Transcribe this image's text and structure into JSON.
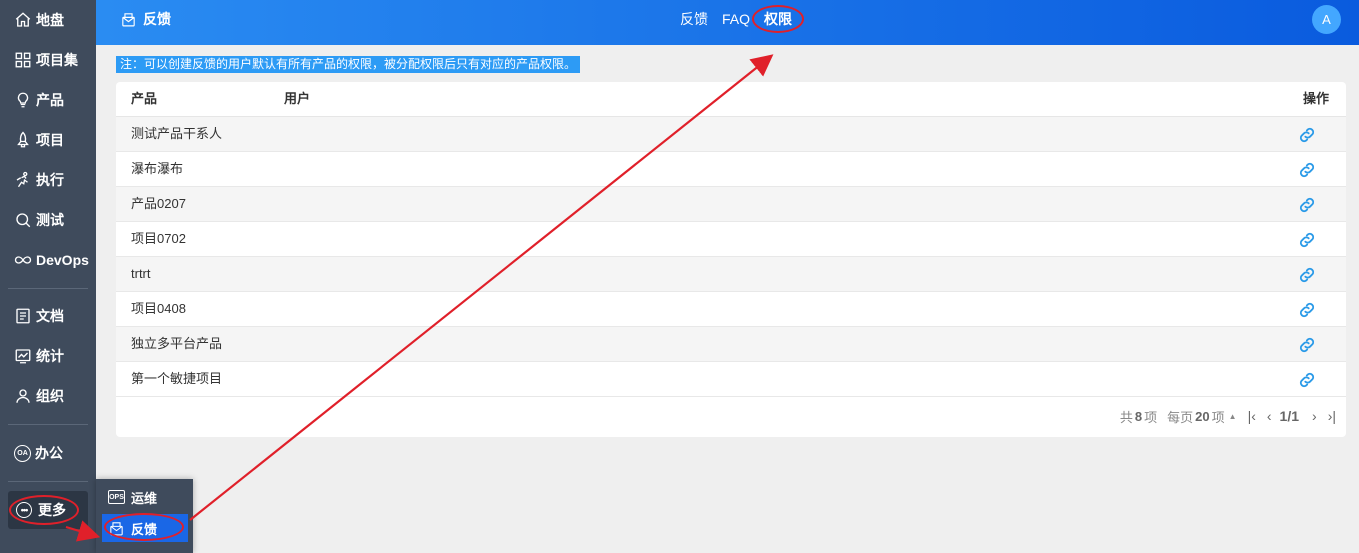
{
  "sidebar": {
    "items": [
      {
        "label": "地盘",
        "icon": "home-icon"
      },
      {
        "label": "项目集",
        "icon": "grid-icon"
      },
      {
        "label": "产品",
        "icon": "lightbulb-icon"
      },
      {
        "label": "项目",
        "icon": "rocket-icon"
      },
      {
        "label": "执行",
        "icon": "run-icon"
      },
      {
        "label": "测试",
        "icon": "magnifier-icon"
      },
      {
        "label": "DevOps",
        "icon": "infinity-icon"
      },
      {
        "label": "文档",
        "icon": "document-icon"
      },
      {
        "label": "统计",
        "icon": "chart-icon"
      },
      {
        "label": "组织",
        "icon": "user-icon"
      },
      {
        "label": "办公",
        "icon": "oa-icon"
      }
    ],
    "more_label": "更多",
    "oa_icon_text": "OA"
  },
  "header": {
    "title": "反馈",
    "tabs": [
      "反馈",
      "FAQ",
      "权限"
    ],
    "active_tab": "权限",
    "avatar": "A"
  },
  "note": "注：可以创建反馈的用户默认有所有产品的权限，被分配权限后只有对应的产品权限。",
  "table": {
    "columns": {
      "product": "产品",
      "user": "用户",
      "action": "操作"
    },
    "rows": [
      {
        "product": "测试产品干系人"
      },
      {
        "product": "瀑布瀑布"
      },
      {
        "product": "产品0207"
      },
      {
        "product": "项目0702"
      },
      {
        "product": "trtrt"
      },
      {
        "product": "项目0408"
      },
      {
        "product": "独立多平台产品"
      },
      {
        "product": "第一个敏捷项目"
      }
    ]
  },
  "pager": {
    "total_prefix": "共",
    "total": "8",
    "total_suffix": "项",
    "per_page_prefix": "每页",
    "per_page": "20",
    "per_page_suffix": "项",
    "page": "1/1"
  },
  "popup": {
    "items": [
      {
        "label": "运维",
        "icon_text": "OPS"
      },
      {
        "label": "反馈"
      }
    ]
  },
  "colors": {
    "sidebar": "#3f4b5c",
    "header_start": "#2a8cf2",
    "header_end": "#0a5bde",
    "accent": "#1a67e6",
    "annotation": "#e0202a"
  }
}
